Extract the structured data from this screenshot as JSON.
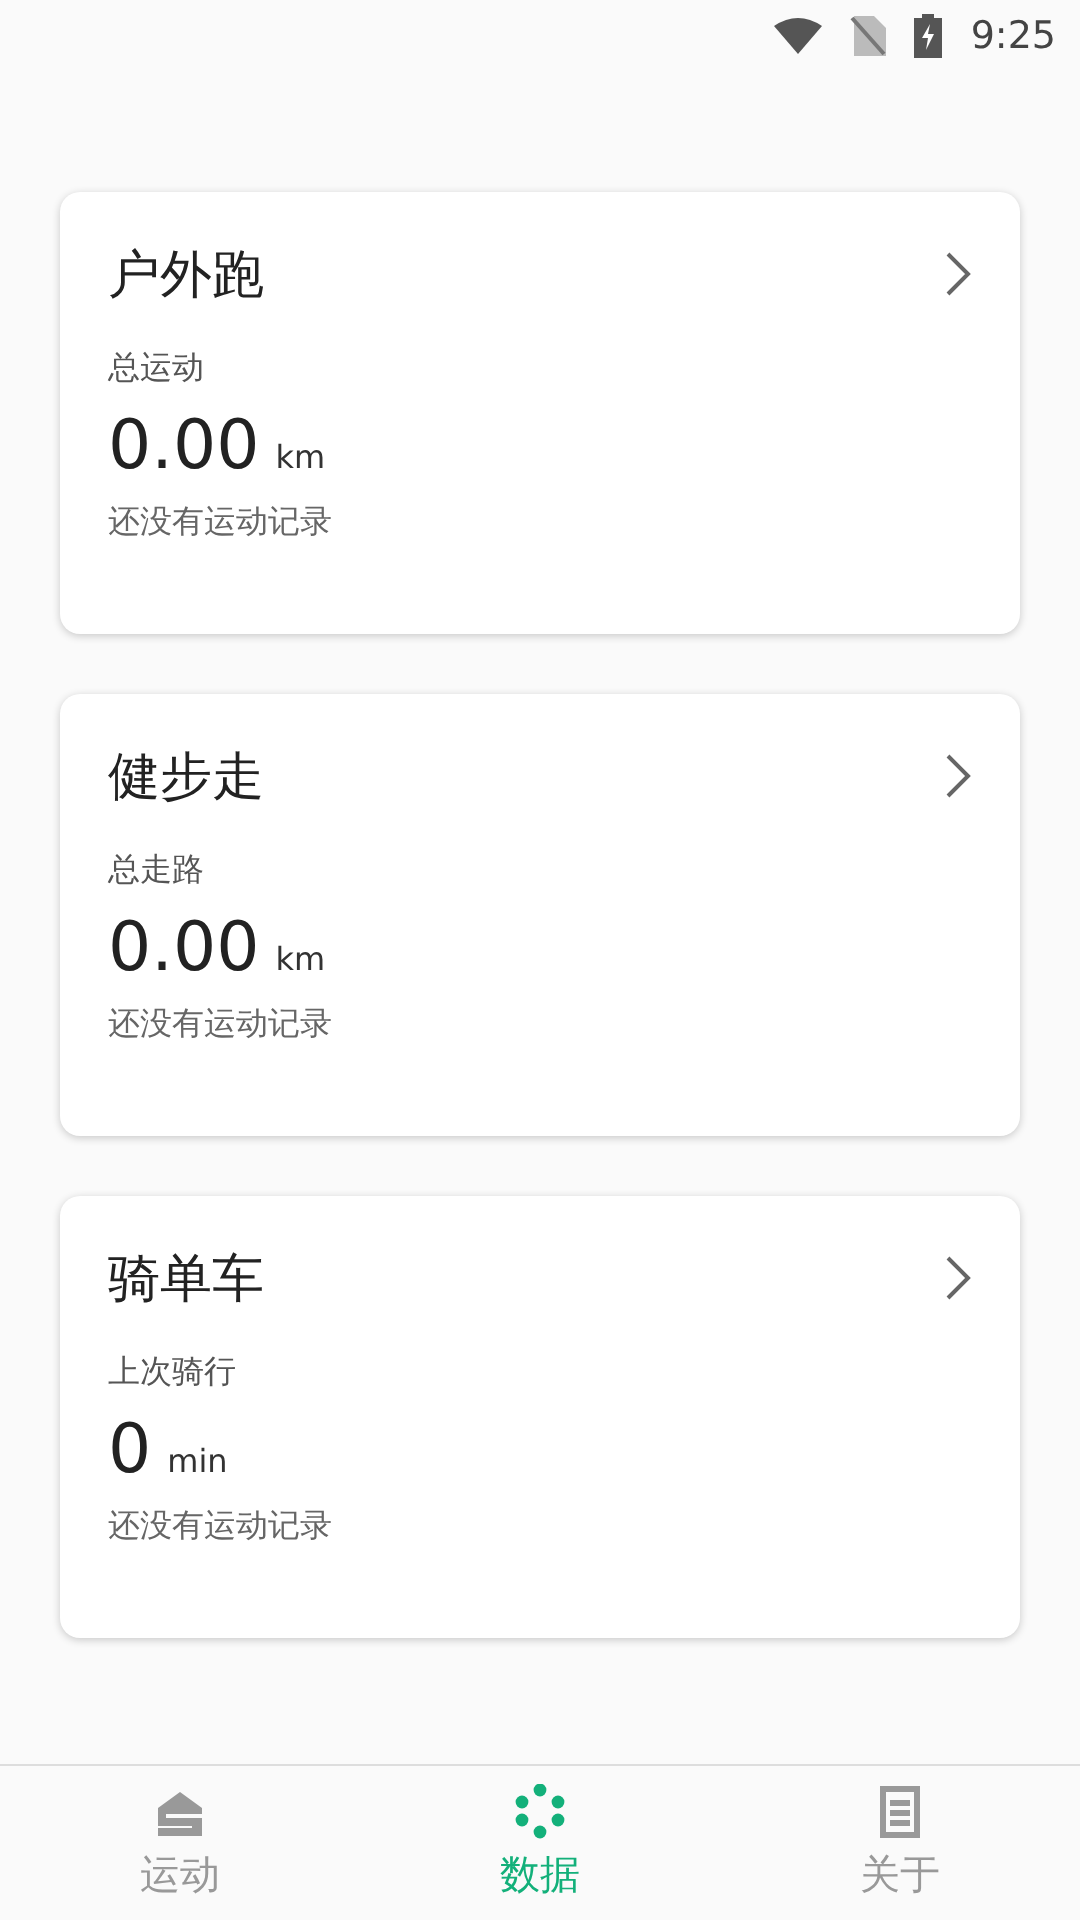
{
  "status_bar": {
    "time": "9:25"
  },
  "cards": [
    {
      "title": "户外跑",
      "metric_label": "总运动",
      "value": "0.00",
      "unit": "km",
      "note": "还没有运动记录"
    },
    {
      "title": "健步走",
      "metric_label": "总走路",
      "value": "0.00",
      "unit": "km",
      "note": "还没有运动记录"
    },
    {
      "title": "骑单车",
      "metric_label": "上次骑行",
      "value": "0",
      "unit": "min",
      "note": "还没有运动记录"
    }
  ],
  "tabs": [
    {
      "label": "运动",
      "kind": "sport",
      "selected": false
    },
    {
      "label": "数据",
      "kind": "data",
      "selected": true
    },
    {
      "label": "关于",
      "kind": "about",
      "selected": false
    }
  ]
}
